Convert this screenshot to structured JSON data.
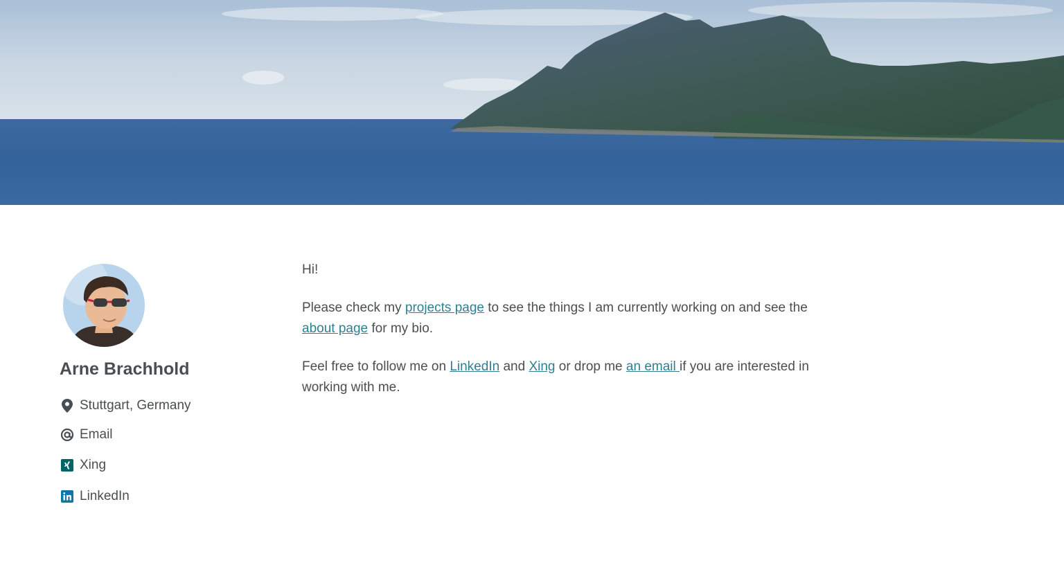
{
  "author": {
    "name": "Arne Brachhold",
    "links": [
      {
        "label": "Stuttgart, Germany",
        "icon": "map-marker-icon"
      },
      {
        "label": "Email",
        "icon": "at-sign-icon"
      },
      {
        "label": "Xing",
        "icon": "xing-icon"
      },
      {
        "label": "LinkedIn",
        "icon": "linkedin-icon"
      }
    ]
  },
  "intro": {
    "greeting": "Hi!",
    "p1": {
      "before": "Please check my ",
      "projects_link": "projects page",
      "middle": " to see the things I am currently working on and see the ",
      "about_link": "about page",
      "after": " for my bio."
    },
    "p2": {
      "before": "Feel free to follow me on ",
      "linkedin_link": "LinkedIn",
      "and": " and ",
      "xing_link": "Xing",
      "middle": " or drop me ",
      "email_link": "an email ",
      "after": "if you are interested in working with me."
    }
  },
  "colors": {
    "text": "#494e52",
    "link": "#2f7f93",
    "xing": "#026466",
    "linkedin": "#0e76a8"
  }
}
